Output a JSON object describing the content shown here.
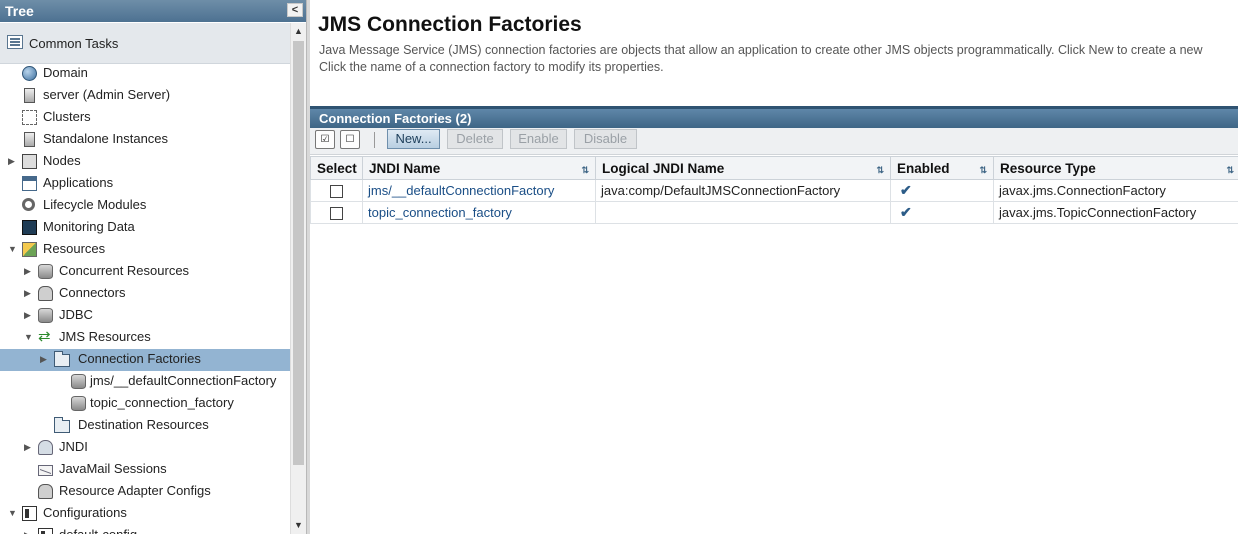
{
  "tree": {
    "title": "Tree",
    "collapse_glyph": "<",
    "common_tasks": "Common Tasks",
    "items": [
      {
        "label": "Domain"
      },
      {
        "label": "server (Admin Server)"
      },
      {
        "label": "Clusters"
      },
      {
        "label": "Standalone Instances"
      },
      {
        "label": "Nodes"
      },
      {
        "label": "Applications"
      },
      {
        "label": "Lifecycle Modules"
      },
      {
        "label": "Monitoring Data"
      },
      {
        "label": "Resources"
      },
      {
        "label": "Concurrent Resources"
      },
      {
        "label": "Connectors"
      },
      {
        "label": "JDBC"
      },
      {
        "label": "JMS Resources"
      },
      {
        "label": "Connection Factories"
      },
      {
        "label": "jms/__defaultConnectionFactory"
      },
      {
        "label": "topic_connection_factory"
      },
      {
        "label": "Destination Resources"
      },
      {
        "label": "JNDI"
      },
      {
        "label": "JavaMail Sessions"
      },
      {
        "label": "Resource Adapter Configs"
      },
      {
        "label": "Configurations"
      },
      {
        "label": "default-config"
      }
    ]
  },
  "page": {
    "title": "JMS Connection Factories",
    "description_line1": "Java Message Service (JMS) connection factories are objects that allow an application to create other JMS objects programmatically. Click New to create a new",
    "description_line2": "Click the name of a connection factory to modify its properties."
  },
  "table": {
    "title": "Connection Factories (2)",
    "toolbar": {
      "select_all_glyph": "☑",
      "deselect_all_glyph": "☐",
      "new_label": "New...",
      "delete_label": "Delete",
      "enable_label": "Enable",
      "disable_label": "Disable"
    },
    "columns": [
      "Select",
      "JNDI Name",
      "Logical JNDI Name",
      "Enabled",
      "Resource Type"
    ],
    "sort_glyph": "⇅",
    "rows": [
      {
        "jndi_name": "jms/__defaultConnectionFactory",
        "logical_jndi_name": "java:comp/DefaultJMSConnectionFactory",
        "enabled": "✔",
        "resource_type": "javax.jms.ConnectionFactory"
      },
      {
        "jndi_name": "topic_connection_factory",
        "logical_jndi_name": "",
        "enabled": "✔",
        "resource_type": "javax.jms.TopicConnectionFactory"
      }
    ]
  },
  "colors": {
    "header_blue": "#4d7191",
    "selection": "#93b4d2",
    "link": "#1a4e86"
  }
}
